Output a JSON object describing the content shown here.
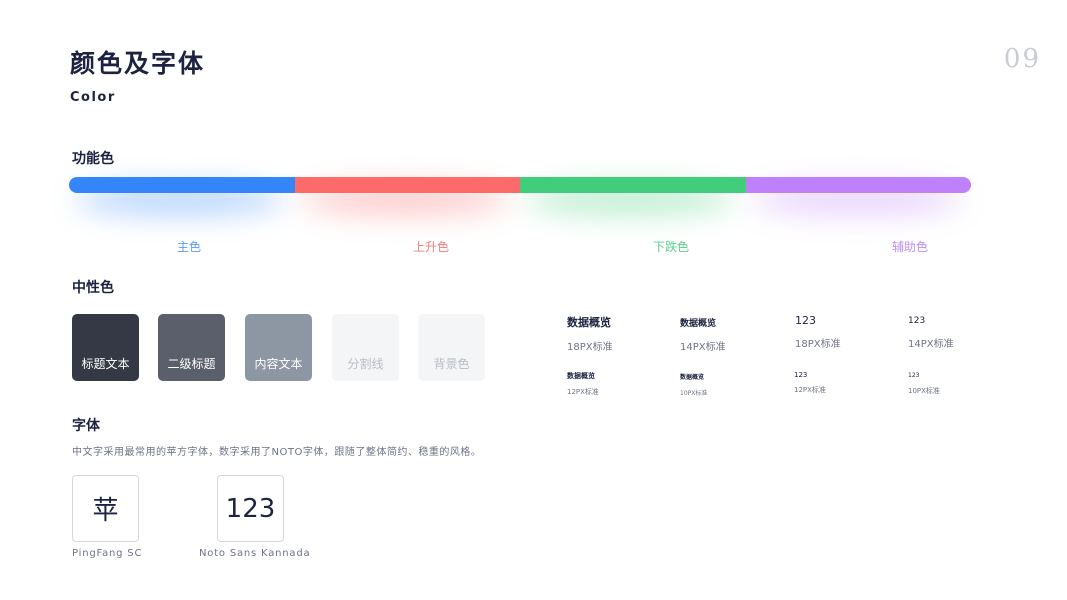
{
  "header": {
    "title": "颜色及字体",
    "subtitle": "Color",
    "page_number": "09"
  },
  "functional": {
    "heading": "功能色",
    "segments": [
      {
        "label": "主色",
        "color": "#3486f8",
        "label_color": "#5b9cf6"
      },
      {
        "label": "上升色",
        "color": "#fc6a6a",
        "label_color": "#f67b7b"
      },
      {
        "label": "下跌色",
        "color": "#42cd7c",
        "label_color": "#5fd08d"
      },
      {
        "label": "辅助色",
        "color": "#bf80fb",
        "label_color": "#c08ff7"
      }
    ]
  },
  "neutral": {
    "heading": "中性色",
    "swatches": [
      {
        "label": "标题文本",
        "bg": "#353945",
        "fg": "#ffffff"
      },
      {
        "label": "二级标题",
        "bg": "#5b5f6b",
        "fg": "#ffffff"
      },
      {
        "label": "内容文本",
        "bg": "#8d96a3",
        "fg": "#ffffff"
      },
      {
        "label": "分割线",
        "bg": "#f4f5f7",
        "fg": "#b8bcc6"
      },
      {
        "label": "背景色",
        "bg": "#f4f5f7",
        "fg": "#b8bcc6"
      }
    ]
  },
  "font_specs": {
    "large": [
      {
        "sample": "数据概览",
        "desc": "18PX标准"
      },
      {
        "sample": "数据概览",
        "desc": "14PX标准"
      },
      {
        "sample": "123",
        "desc": "18PX标准"
      },
      {
        "sample": "123",
        "desc": "14PX标准"
      }
    ],
    "small": [
      {
        "sample": "数据概览",
        "desc": "12PX标准"
      },
      {
        "sample": "数据概览",
        "desc": "10PX标准"
      },
      {
        "sample": "123",
        "desc": "12PX标准"
      },
      {
        "sample": "123",
        "desc": "10PX标准"
      }
    ]
  },
  "fonts": {
    "heading": "字体",
    "description": "中文字采用最常用的苹方字体，数字采用了NOTO字体，跟随了整体简约、稳重的风格。",
    "samples": [
      {
        "glyph": "苹",
        "name": "PingFang SC"
      },
      {
        "glyph": "123",
        "name": "Noto Sans Kannada"
      }
    ]
  }
}
